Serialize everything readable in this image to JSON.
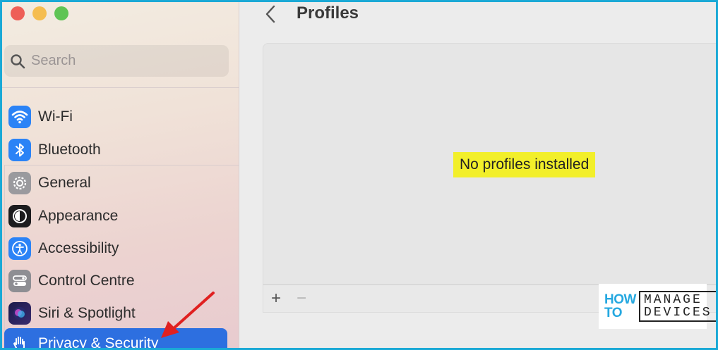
{
  "window": {
    "controls": [
      "close",
      "minimize",
      "zoom"
    ]
  },
  "sidebar": {
    "search": {
      "placeholder": "Search",
      "value": ""
    },
    "items": [
      {
        "label": "Wi-Fi",
        "icon": "wifi-icon",
        "color": "#2b83f6"
      },
      {
        "label": "Bluetooth",
        "icon": "bluetooth-icon",
        "color": "#2b83f6"
      },
      {
        "label": "General",
        "icon": "gear-icon",
        "color": "#8e8e93"
      },
      {
        "label": "Appearance",
        "icon": "appearance-icon",
        "color": "#1c1c1e"
      },
      {
        "label": "Accessibility",
        "icon": "accessibility-icon",
        "color": "#2b83f6"
      },
      {
        "label": "Control Centre",
        "icon": "control-centre-icon",
        "color": "#8e8e93"
      },
      {
        "label": "Siri & Spotlight",
        "icon": "siri-icon",
        "color": "#2a2a6e"
      },
      {
        "label": "Privacy & Security",
        "icon": "hand-icon",
        "color": "#2d6fe0",
        "selected": true
      }
    ]
  },
  "main": {
    "title": "Profiles",
    "empty_message": "No profiles installed",
    "toolbar": {
      "add_label": "+",
      "remove_label": "−"
    }
  },
  "logo": {
    "left_lines": [
      "HOW",
      "TO"
    ],
    "right_lines": [
      "MANAGE",
      "DEVICES"
    ]
  },
  "colors": {
    "selected": "#2d6fe0",
    "highlight": "#f2ef2a",
    "frame": "#1aa9d6",
    "annotation_arrow": "#e02020"
  }
}
